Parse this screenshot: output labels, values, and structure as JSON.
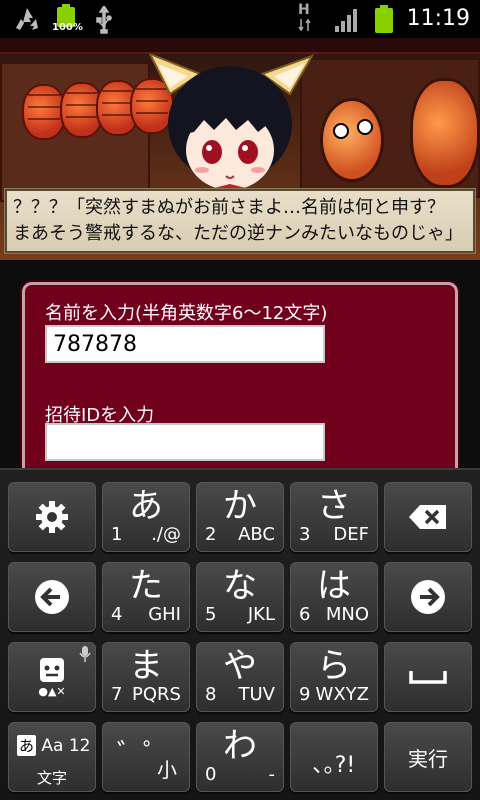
{
  "status_bar": {
    "battery_small_percent": "100%",
    "network_type": "H",
    "time": "11:19"
  },
  "banner": {
    "dialog_line1": "？？？「突然すまぬがお前さまよ…名前は何と申す？",
    "dialog_line2": "まあそう警戒するな、ただの逆ナンみたいなものじゃ」"
  },
  "form": {
    "name_label": "名前を入力(半角英数字6～12文字)",
    "name_value": "787878",
    "invite_label": "招待IDを入力",
    "invite_value": ""
  },
  "keyboard": {
    "row1": [
      {
        "id": "settings",
        "icon": "gear-icon"
      },
      {
        "main": "あ",
        "num": "1",
        "sub": "./@"
      },
      {
        "main": "か",
        "num": "2",
        "sub": "ABC"
      },
      {
        "main": "さ",
        "num": "3",
        "sub": "DEF"
      },
      {
        "id": "backspace",
        "icon": "backspace-icon"
      }
    ],
    "row2": [
      {
        "id": "left",
        "icon": "arrow-left-icon"
      },
      {
        "main": "た",
        "num": "4",
        "sub": "GHI"
      },
      {
        "main": "な",
        "num": "5",
        "sub": "JKL"
      },
      {
        "main": "は",
        "num": "6",
        "sub": "MNO"
      },
      {
        "id": "right",
        "icon": "arrow-right-icon"
      }
    ],
    "row3": [
      {
        "id": "emoji",
        "icon": "emoji-icon",
        "sub": "●▲✕"
      },
      {
        "main": "ま",
        "num": "7",
        "sub": "PQRS"
      },
      {
        "main": "や",
        "num": "8",
        "sub": "TUV"
      },
      {
        "main": "ら",
        "num": "9",
        "sub": "WXYZ"
      },
      {
        "id": "space",
        "icon": "space-icon"
      }
    ],
    "row4": {
      "mode_top_a": "あ",
      "mode_top_rest": " Aa 12",
      "mode_bottom": "文字",
      "dakuten": "゛゜",
      "small": "小",
      "wa_main": "わ",
      "wa_num": "0",
      "wa_sub": "-",
      "punct": "､｡?!",
      "enter": "実行"
    }
  }
}
